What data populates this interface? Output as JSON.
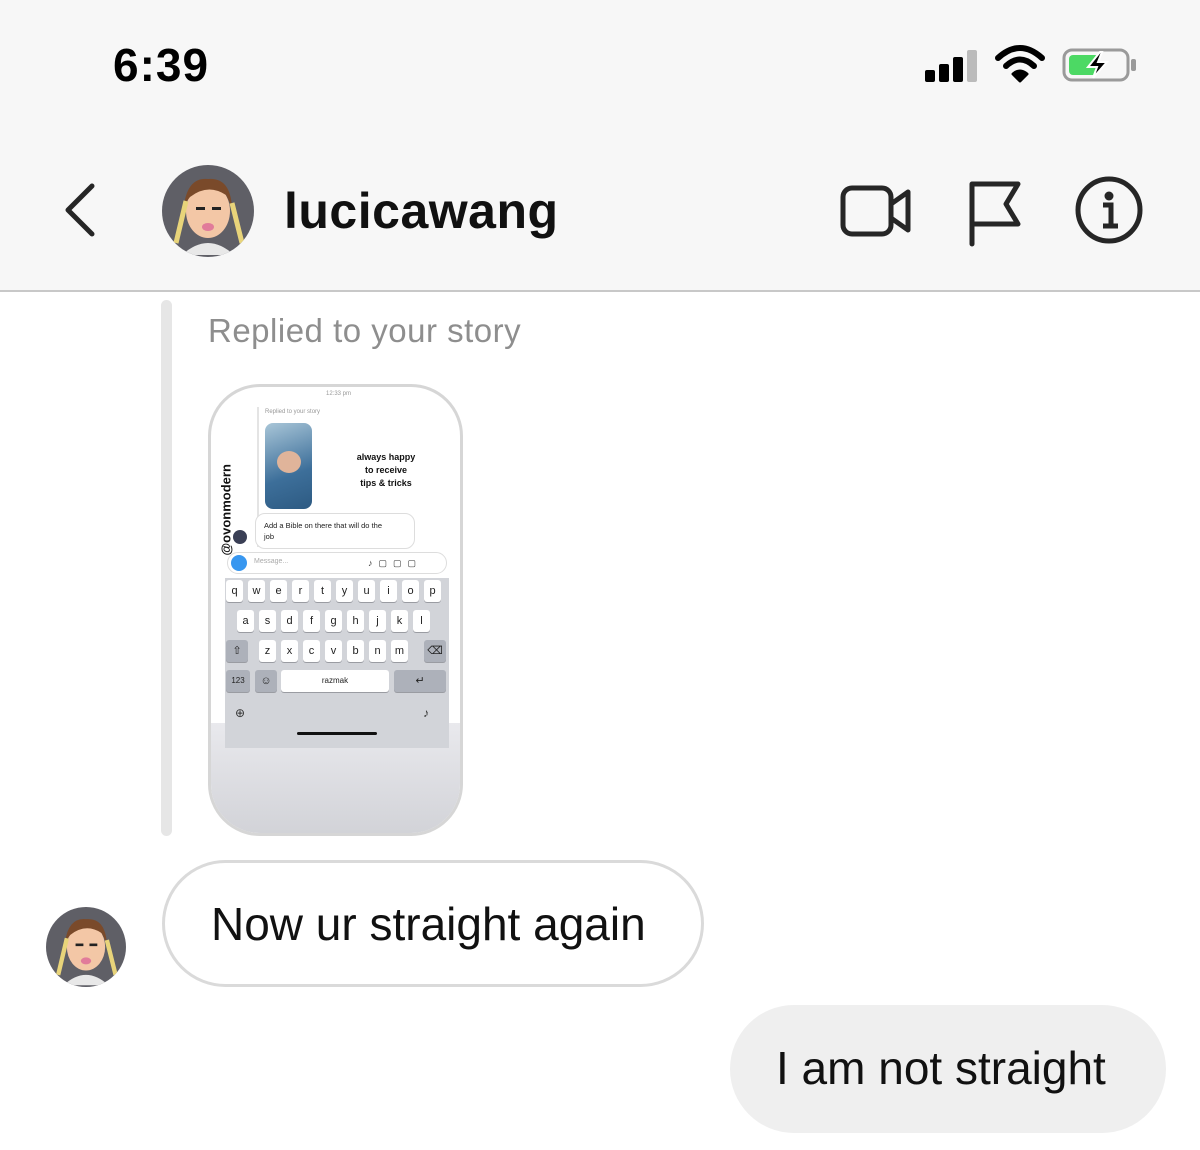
{
  "status_bar": {
    "time": "6:39"
  },
  "header": {
    "username": "lucicawang"
  },
  "thread": {
    "reply_label": "Replied to your story",
    "story": {
      "time": "12:33 pm",
      "replied_label": "Replied to your story",
      "vertical_handle": "@ovonmodern",
      "caption_lines": [
        "always happy",
        "to receive",
        "tips & tricks"
      ],
      "reply_text_lines": [
        "Add a Bible on there that will do the",
        "job"
      ],
      "message_placeholder": "Message...",
      "keyboard_row1": [
        "q",
        "w",
        "e",
        "r",
        "t",
        "y",
        "u",
        "i",
        "o",
        "p"
      ],
      "keyboard_row2": [
        "a",
        "s",
        "d",
        "f",
        "g",
        "h",
        "j",
        "k",
        "l"
      ],
      "keyboard_row3": [
        "z",
        "x",
        "c",
        "v",
        "b",
        "n",
        "m"
      ],
      "key_numbers": "123",
      "space_label": "razmak"
    },
    "messages": [
      {
        "direction": "incoming",
        "text": "Now ur straight again"
      },
      {
        "direction": "outgoing",
        "text": "I am not straight"
      }
    ]
  },
  "icons": [
    "signal-icon",
    "wifi-icon",
    "battery-icon",
    "back-icon",
    "video-call-icon",
    "flag-icon",
    "info-icon"
  ],
  "colors": {
    "header_bg": "#f7f7f7",
    "bubble_out_bg": "#efefef",
    "muted_text": "#8e8e8e",
    "battery_green": "#4cd964"
  }
}
